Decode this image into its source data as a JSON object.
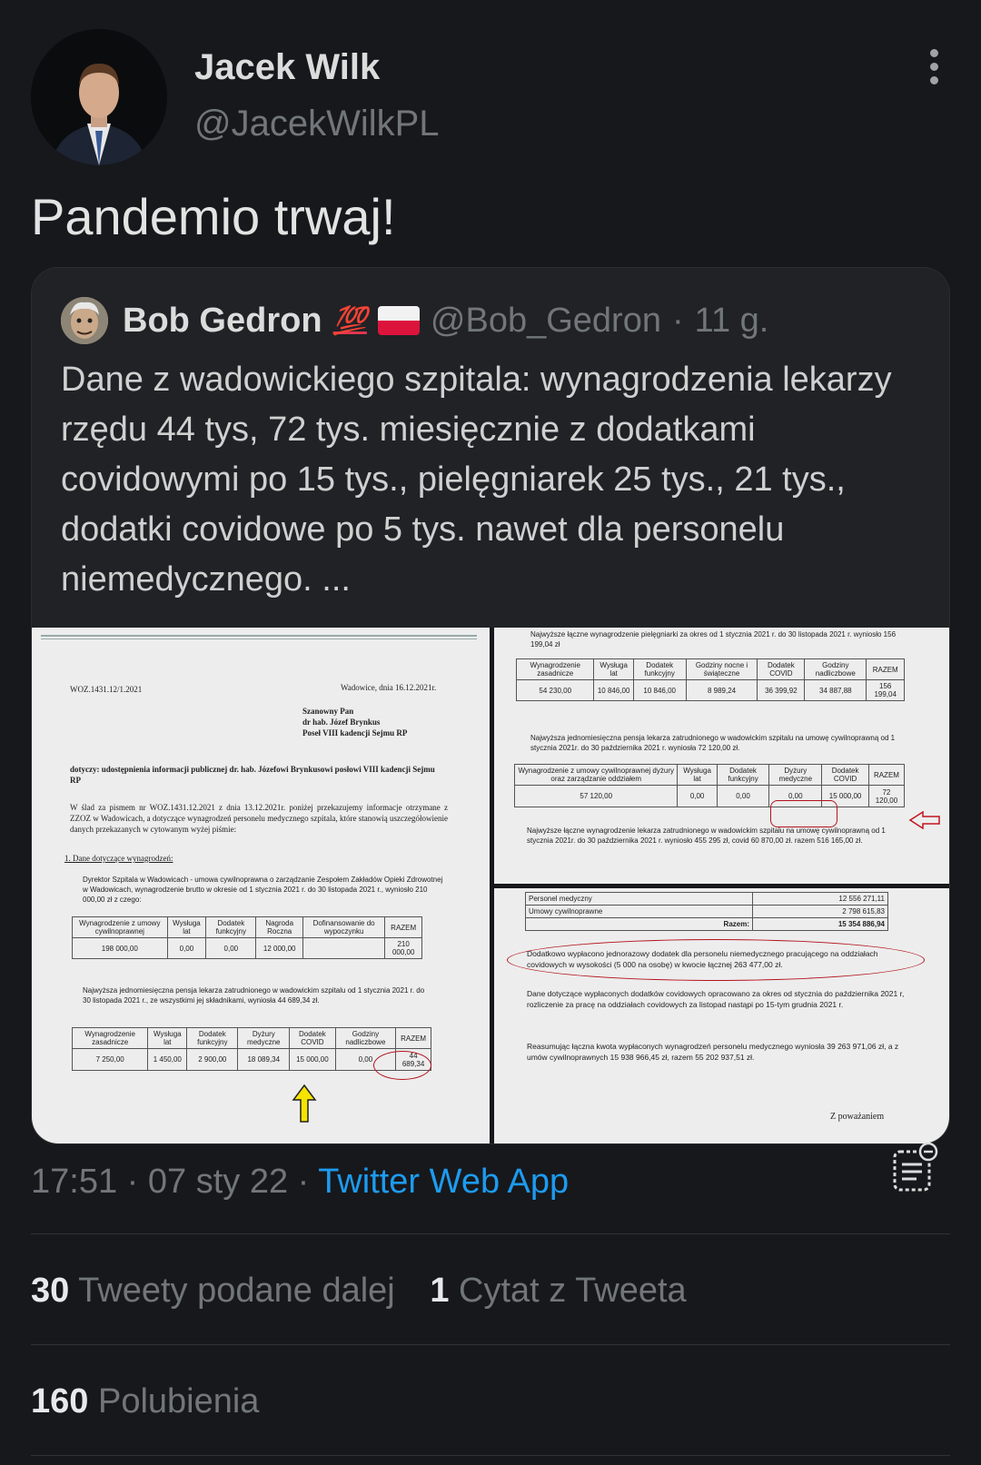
{
  "author": {
    "name": "Jacek Wilk",
    "handle": "@JacekWilkPL"
  },
  "tweet": {
    "text": "Pandemio trwaj!"
  },
  "quoted": {
    "name": "Bob Gedron",
    "emoji": "💯",
    "handle": "@Bob_Gedron",
    "separator": "·",
    "age": "11 g.",
    "text": "Dane z wadowickiego szpitala: wynagrodzenia lekarzy rzędu 44 tys,  72 tys. miesięcznie z dodatkami covidowymi po 15 tys., pielęgniarek 25 tys., 21 tys., dodatki covidowe po 5 tys. nawet dla personelu niemedycznego. ...",
    "doc_a": {
      "ref": "WOZ.1431.12/1.2021",
      "place_date": "Wadowice, dnia 16.12.2021r.",
      "addressee": [
        "Szanowny Pan",
        "dr hab. Józef Brynkus",
        "Poseł VIII kadencji Sejmu RP"
      ],
      "subject": "dotyczy: udostępnienia informacji publicznej dr. hab. Józefowi Brynkusowi posłowi VIII kadencji Sejmu RP",
      "body": "W ślad za pismem nr WOZ.1431.12.2021 z dnia 13.12.2021r. poniżej przekazujemy informacje otrzymane z ZZOZ w Wadowicach, a dotyczące wynagrodzeń personelu medycznego szpitala, które stanowią uszczegółowienie danych przekazanych w cytowanym wyżej piśmie:",
      "list_item": "1.  Dane dotyczące wynagrodzeń:",
      "bullet1": "Dyrektor Szpitala w Wadowicach - umowa cywilnoprawna o zarządzanie Zespołem Zakładów Opieki Zdrowotnej w Wadowicach, wynagrodzenie brutto w okresie od 1 stycznia 2021 r. do 30 listopada 2021 r., wyniosło 210 000,00 zł z czego:",
      "table1_head": [
        "Wynagrodzenie z umowy cywilnoprawnej",
        "Wysługa lat",
        "Dodatek funkcyjny",
        "Nagroda Roczna",
        "Dofinansowanie do wypoczynku",
        "RAZEM"
      ],
      "table1_row": [
        "198 000,00",
        "0,00",
        "0,00",
        "12 000,00",
        "",
        "210 000,00"
      ],
      "bullet2": "Najwyższa jednomiesięczna pensja lekarza zatrudnionego w wadowickim szpitalu od 1 stycznia 2021 r. do 30 listopada 2021 r., ze wszystkimi jej składnikami, wyniosła 44 689,34 zł.",
      "table2_head": [
        "Wynagrodzenie zasadnicze",
        "Wysługa lat",
        "Dodatek funkcyjny",
        "Dyżury medyczne",
        "Dodatek COVID",
        "Godziny nadliczbowe",
        "RAZEM"
      ],
      "table2_row": [
        "7 250,00",
        "1 450,00",
        "2 900,00",
        "18 089,34",
        "15 000,00",
        "0,00",
        "44 689,34"
      ]
    },
    "doc_b": {
      "line1": "Najwyższe łączne wynagrodzenie pielęgniarki za okres od 1 stycznia 2021 r. do 30 listopada 2021 r. wyniosło 156 199,04 zł",
      "table1_head": [
        "Wynagrodzenie zasadnicze",
        "Wysługa lat",
        "Dodatek funkcyjny",
        "Godziny nocne i świąteczne",
        "Dodatek COVID",
        "Godziny nadliczbowe",
        "RAZEM"
      ],
      "table1_row": [
        "54 230,00",
        "10 846,00",
        "10 846,00",
        "8 989,24",
        "36 399,92",
        "34 887,88",
        "156 199,04"
      ],
      "line2": "Najwyższa jednomiesięczna pensja lekarza zatrudnionego w wadowickim szpitalu na umowę cywilnoprawną od 1 stycznia 2021r. do 30 października 2021 r. wyniosła 72 120,00 zł.",
      "table2_head": [
        "Wynagrodzenie z umowy cywilnoprawnej dyżury oraz zarządzanie oddziałem",
        "Wysługa lat",
        "Dodatek funkcyjny",
        "Dyżury medyczne",
        "Dodatek COVID",
        "RAZEM"
      ],
      "table2_row": [
        "57 120,00",
        "0,00",
        "0,00",
        "0,00",
        "15 000,00",
        "72 120,00"
      ],
      "line3": "Najwyższe łączne wynagrodzenie lekarza zatrudnionego w wadowickim szpitalu na umowę cywilnoprawną od 1 stycznia 2021r. do 30 października 2021 r. wyniosło 455 295 zł, covid 60 870,00 zł. razem 516 165,00 zł."
    },
    "doc_c": {
      "rows": [
        {
          "label": "Personel medyczny",
          "value": "12 556 271,11"
        },
        {
          "label": "Umowy cywilnoprawne",
          "value": "2 798 615,83"
        },
        {
          "label": "Razem:",
          "value": "15 354 886,94"
        }
      ],
      "highlight": "Dodatkowo wypłacono jednorazowy dodatek dla personelu niemedycznego pracującego na oddziałach covidowych w wysokości (5 000 na osobę) w kwocie łącznej 263 477,00 zł.",
      "para1": "Dane dotyczące wypłaconych dodatków covidowych opracowano za okres od stycznia do października 2021 r, rozliczenie za pracę na oddziałach covidowych za listopad nastąpi po 15-tym grudnia 2021 r.",
      "para2": "Reasumując łączna kwota wypłaconych wynagrodzeń personelu medycznego wyniosła 39 263 971,06 zł, a z umów cywilnoprawnych 15 938 966,45 zł, razem 55 202 937,51 zł.",
      "closing": "Z poważaniem"
    }
  },
  "meta": {
    "time": "17:51",
    "date": "07 sty 22",
    "dot": "·",
    "app": "Twitter Web App"
  },
  "stats": {
    "retweets_count": "30",
    "retweets_label": "Tweety podane dalej",
    "quotes_count": "1",
    "quotes_label": "Cytat z Tweeta",
    "likes_count": "160",
    "likes_label": "Polubienia"
  }
}
